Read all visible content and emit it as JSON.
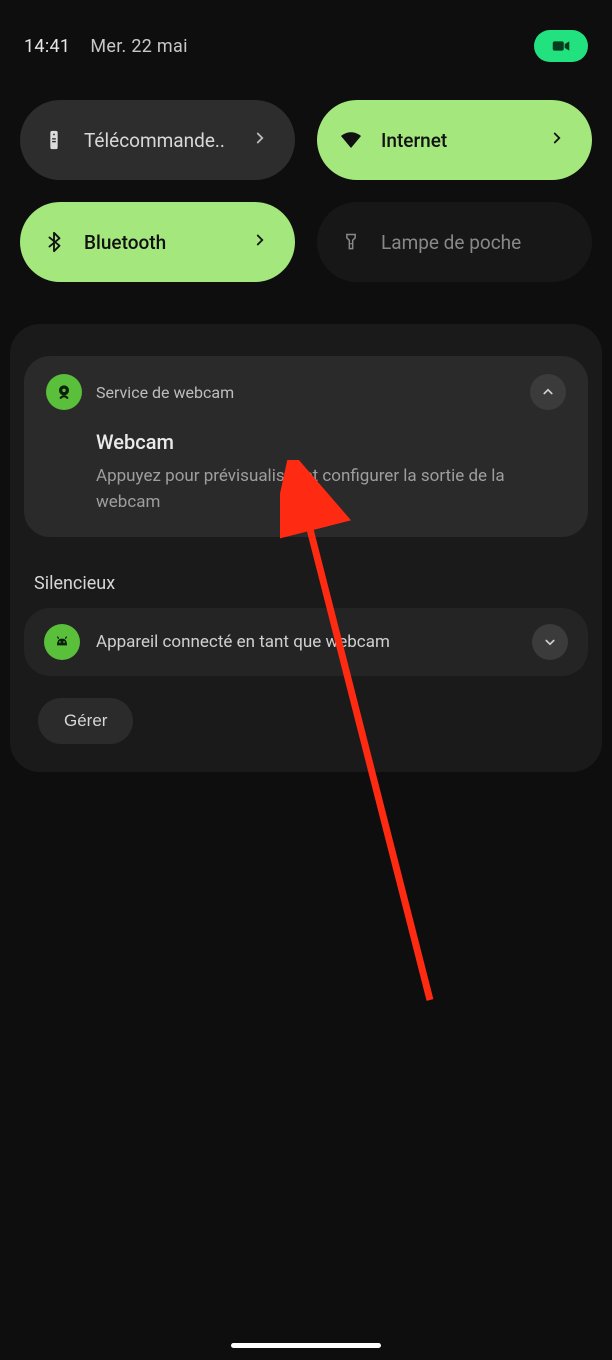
{
  "status": {
    "time": "14:41",
    "date": "Mer. 22 mai"
  },
  "qs": {
    "remote": "Télécommande..",
    "internet": "Internet",
    "bluetooth": "Bluetooth",
    "flashlight": "Lampe de poche"
  },
  "notif_webcam": {
    "app": "Service de webcam",
    "title": "Webcam",
    "body": "Appuyez pour prévisualiser et configurer la sortie de la webcam"
  },
  "silent_label": "Silencieux",
  "notif_device": {
    "text": "Appareil connecté en tant que webcam"
  },
  "manage": "Gérer"
}
